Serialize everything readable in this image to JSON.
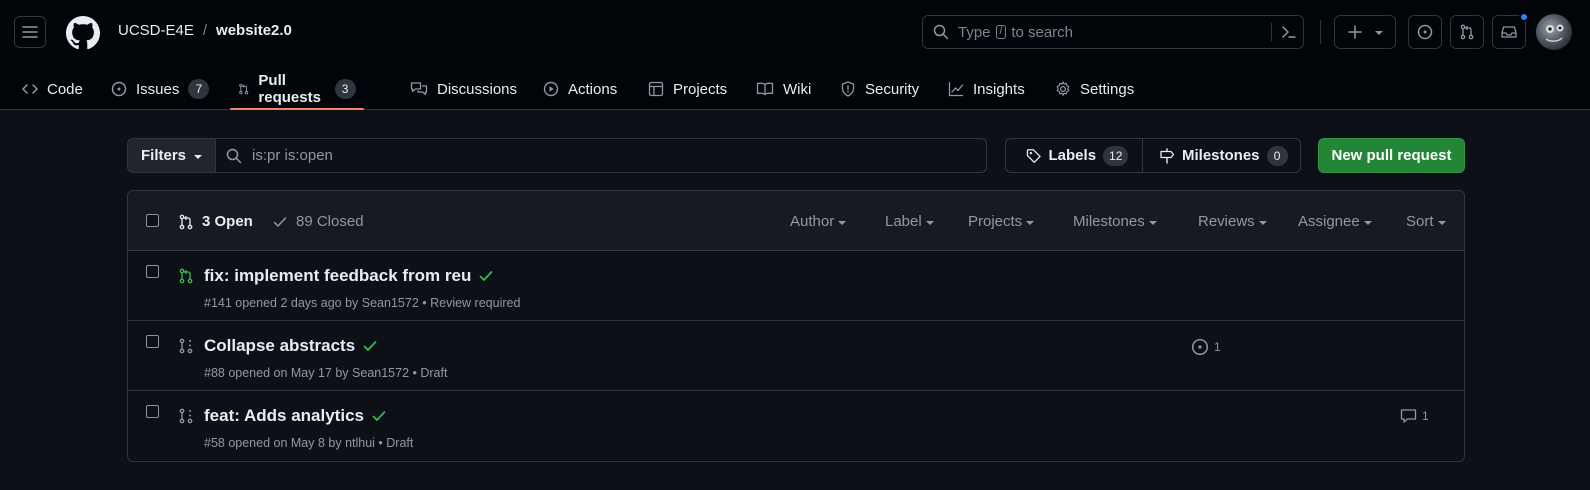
{
  "header": {
    "org": "UCSD-E4E",
    "separator": "/",
    "repo": "website2.0",
    "search_prefix": "Type",
    "search_key": "/",
    "search_suffix": "to search"
  },
  "nav": {
    "tabs": [
      {
        "label": "Code",
        "icon": "code-icon"
      },
      {
        "label": "Issues",
        "icon": "issue-opened-icon",
        "count": "7"
      },
      {
        "label": "Pull requests",
        "icon": "git-pull-request-icon",
        "count": "3",
        "active": true
      },
      {
        "label": "Discussions",
        "icon": "comment-discussion-icon"
      },
      {
        "label": "Actions",
        "icon": "play-icon"
      },
      {
        "label": "Projects",
        "icon": "table-icon"
      },
      {
        "label": "Wiki",
        "icon": "book-icon"
      },
      {
        "label": "Security",
        "icon": "shield-icon"
      },
      {
        "label": "Insights",
        "icon": "graph-icon"
      },
      {
        "label": "Settings",
        "icon": "gear-icon"
      }
    ]
  },
  "filterbar": {
    "filters_label": "Filters",
    "query": "is:pr is:open",
    "labels_label": "Labels",
    "labels_count": "12",
    "milestones_label": "Milestones",
    "milestones_count": "0",
    "new_pr_label": "New pull request"
  },
  "list": {
    "open_label": "3 Open",
    "closed_label": "89 Closed",
    "header_filters": [
      "Author",
      "Label",
      "Projects",
      "Milestones",
      "Reviews",
      "Assignee",
      "Sort"
    ],
    "rows": [
      {
        "title": "fix: implement feedback from reu",
        "meta": "#141 opened 2 days ago by Sean1572 • Review required",
        "state": "open",
        "check": "success"
      },
      {
        "title": "Collapse abstracts",
        "meta": "#88 opened on May 17 by Sean1572 • Draft",
        "state": "draft",
        "check": "success",
        "linked_issues": "1"
      },
      {
        "title": "feat: Adds analytics",
        "meta": "#58 opened on May 8 by ntlhui • Draft",
        "state": "draft",
        "check": "success",
        "comments": "1"
      }
    ]
  },
  "colors": {
    "background": "#0d1117",
    "header_bg": "#010409",
    "accent_active_tab": "#f78166",
    "primary_button": "#238636",
    "success": "#3fb950",
    "muted": "#9198a1"
  }
}
